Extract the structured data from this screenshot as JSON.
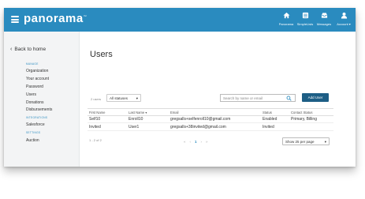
{
  "app": {
    "logo": "panorama",
    "logo_mark": "™"
  },
  "nav": [
    {
      "label": "Panorama",
      "icon": "home-icon"
    },
    {
      "label": "SimpleLists",
      "icon": "list-icon"
    },
    {
      "label": "Messages",
      "icon": "inbox-icon"
    },
    {
      "label": "Account ▾",
      "icon": "user-icon"
    }
  ],
  "sidebar": {
    "back": "Back to home",
    "sections": {
      "manage": "MANAGE",
      "integrations": "INTEGRATIONS",
      "settings": "SETTINGS"
    },
    "items": {
      "organization": "Organization",
      "your_account": "Your account",
      "password": "Password",
      "users": "Users",
      "donations": "Donations",
      "disbursements": "Disbursements",
      "salesforce": "Salesforce",
      "auction": "Auction"
    }
  },
  "main": {
    "title": "Users",
    "user_count": "2 users",
    "status_filter": "All statuses",
    "search_placeholder": "Search by name or email",
    "add_button": "Add User"
  },
  "table": {
    "headers": {
      "first_name": "First Name",
      "last_name": "Last Name",
      "sort_indicator": "▾",
      "email": "Email",
      "status": "Status",
      "contact_status": "Contact Status"
    },
    "rows": [
      {
        "first_name": "Self10",
        "last_name": "Enroll10",
        "email": "gregsalls+selfenroll10@gmail.com",
        "status": "Enabled",
        "contact_status": "Primary, Billing"
      },
      {
        "first_name": "Invited",
        "last_name": "User1",
        "email": "gregsalls+38invited@gmail.com",
        "status": "Invited",
        "contact_status": ""
      }
    ]
  },
  "pagination": {
    "info": "1 - 2 of 2",
    "first": "«",
    "prev": "‹",
    "current": "1",
    "next": "›",
    "last": "»",
    "page_size": "Show 25 per page"
  },
  "colors": {
    "header": "#2a8bbf",
    "button": "#1d5e85"
  }
}
